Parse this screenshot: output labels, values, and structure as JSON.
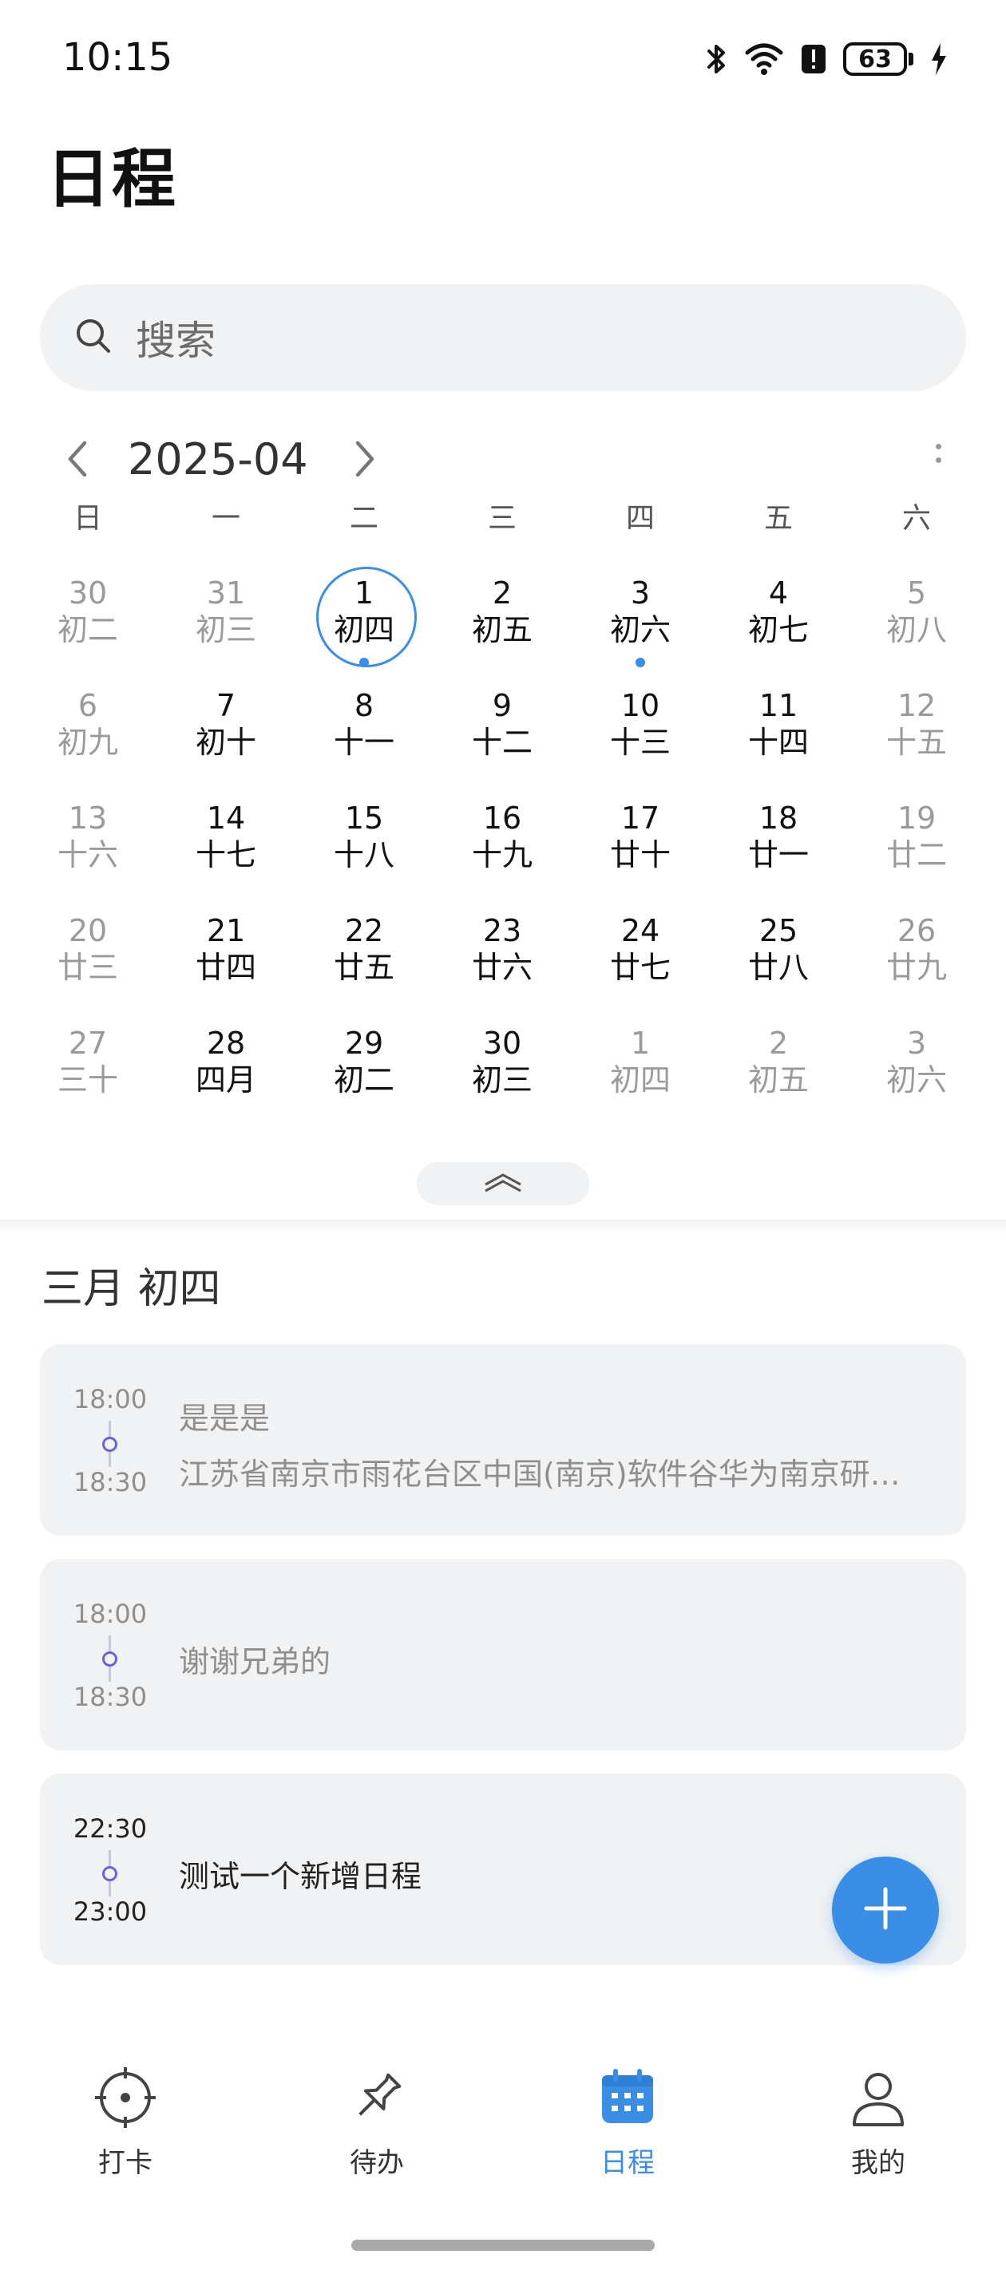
{
  "status_bar": {
    "time": "10:15",
    "battery": "63"
  },
  "header": {
    "title": "日程"
  },
  "search": {
    "placeholder": "搜索"
  },
  "calendar": {
    "month": "2025-04",
    "weekdays": [
      "日",
      "一",
      "二",
      "三",
      "四",
      "五",
      "六"
    ],
    "weeks": [
      [
        {
          "num": "30",
          "lunar": "初二",
          "dim": true
        },
        {
          "num": "31",
          "lunar": "初三",
          "dim": true
        },
        {
          "num": "1",
          "lunar": "初四",
          "selected": true,
          "event": true
        },
        {
          "num": "2",
          "lunar": "初五"
        },
        {
          "num": "3",
          "lunar": "初六",
          "event": true
        },
        {
          "num": "4",
          "lunar": "初七"
        },
        {
          "num": "5",
          "lunar": "初八",
          "dim": true
        }
      ],
      [
        {
          "num": "6",
          "lunar": "初九",
          "dim": true
        },
        {
          "num": "7",
          "lunar": "初十"
        },
        {
          "num": "8",
          "lunar": "十一"
        },
        {
          "num": "9",
          "lunar": "十二"
        },
        {
          "num": "10",
          "lunar": "十三"
        },
        {
          "num": "11",
          "lunar": "十四"
        },
        {
          "num": "12",
          "lunar": "十五",
          "dim": true
        }
      ],
      [
        {
          "num": "13",
          "lunar": "十六",
          "dim": true
        },
        {
          "num": "14",
          "lunar": "十七"
        },
        {
          "num": "15",
          "lunar": "十八"
        },
        {
          "num": "16",
          "lunar": "十九"
        },
        {
          "num": "17",
          "lunar": "廿十"
        },
        {
          "num": "18",
          "lunar": "廿一"
        },
        {
          "num": "19",
          "lunar": "廿二",
          "dim": true
        }
      ],
      [
        {
          "num": "20",
          "lunar": "廿三",
          "dim": true
        },
        {
          "num": "21",
          "lunar": "廿四"
        },
        {
          "num": "22",
          "lunar": "廿五"
        },
        {
          "num": "23",
          "lunar": "廿六"
        },
        {
          "num": "24",
          "lunar": "廿七"
        },
        {
          "num": "25",
          "lunar": "廿八"
        },
        {
          "num": "26",
          "lunar": "廿九",
          "dim": true
        }
      ],
      [
        {
          "num": "27",
          "lunar": "三十",
          "dim": true
        },
        {
          "num": "28",
          "lunar": "四月"
        },
        {
          "num": "29",
          "lunar": "初二"
        },
        {
          "num": "30",
          "lunar": "初三"
        },
        {
          "num": "1",
          "lunar": "初四",
          "dim": true
        },
        {
          "num": "2",
          "lunar": "初五",
          "dim": true
        },
        {
          "num": "3",
          "lunar": "初六",
          "dim": true
        }
      ]
    ]
  },
  "selected_date_label": "三月  初四",
  "events": [
    {
      "start": "18:00",
      "end": "18:30",
      "title": "是是是",
      "location": "江苏省南京市雨花台区中国(南京)软件谷华为南京研究所",
      "state": "past"
    },
    {
      "start": "18:00",
      "end": "18:30",
      "title": "谢谢兄弟的",
      "location": "",
      "state": "past"
    },
    {
      "start": "22:30",
      "end": "23:00",
      "title": "测试一个新增日程",
      "location": "",
      "state": "upcoming"
    }
  ],
  "bottom_nav": [
    {
      "label": "打卡",
      "icon": "crosshair-icon"
    },
    {
      "label": "待办",
      "icon": "pin-icon"
    },
    {
      "label": "日程",
      "icon": "calendar-icon",
      "active": true
    },
    {
      "label": "我的",
      "icon": "person-icon"
    }
  ],
  "colors": {
    "accent": "#3a8ee6",
    "event_dot": "#6a63d6",
    "card_bg": "#f1f2f3"
  }
}
